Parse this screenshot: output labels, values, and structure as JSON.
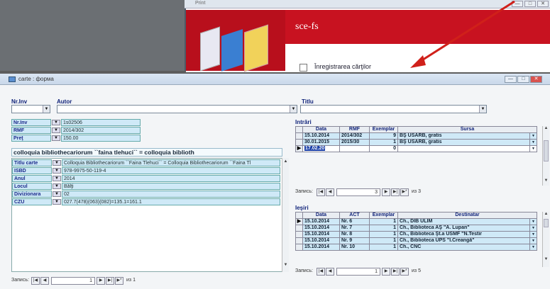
{
  "background_window": {
    "title": "Print",
    "brand": "sce-fs",
    "register_label": "Înregistrarea cărţilor"
  },
  "window": {
    "title": "carte : форма",
    "controls": [
      "—",
      "□",
      "✕"
    ]
  },
  "filters": {
    "nr_inv_label": "Nr.Inv",
    "autor_label": "Autor",
    "titlu_label": "Titlu"
  },
  "record": {
    "nr_inv": {
      "label": "Nr.Inv",
      "value": "1s02506"
    },
    "rmf": {
      "label": "RMF",
      "value": "2014/302"
    },
    "pret": {
      "label": "Preţ",
      "value": "150.00"
    },
    "title_line": "colloquia bibliothecariorum ``faina tlehuci`` = colloquia biblioth",
    "titlu_carte": {
      "label": "Titlu carte",
      "value": "Colloquia Bibliothecariorum ``Faina Tlehuci`` = Colloquia Bibliothecariorum ``Faina Tl"
    },
    "isbn": {
      "label": "ISBD",
      "value": "978-9975-50-119-4"
    },
    "anul": {
      "label": "Anul",
      "value": "2014"
    },
    "locul": {
      "label": "Locul",
      "value": "Bălţi"
    },
    "divizionara": {
      "label": "Divizionara",
      "value": "02"
    },
    "czu": {
      "label": "CZU",
      "value": "027.7(478)(063)(082)=135.1=161.1"
    }
  },
  "intrari": {
    "label": "Intrări",
    "headers": [
      "Data",
      "RMF",
      "Exemplar",
      "Sursa"
    ],
    "rows": [
      [
        "15.10.2014",
        "2014/302",
        "9",
        "BŞ USARB, gratis"
      ],
      [
        "30.01.2015",
        "2015/30",
        "1",
        "BŞ USARB, gratis"
      ],
      [
        "17.02.20",
        "",
        "0",
        ""
      ]
    ],
    "nav": {
      "label": "Запись:",
      "current": "3",
      "total_text": "из 3"
    }
  },
  "iesiri": {
    "label": "Ieşiri",
    "headers": [
      "Data",
      "ACT",
      "Exemplar",
      "Destinatar"
    ],
    "rows": [
      [
        "15.10.2014",
        "Nr. 6",
        "1",
        "Ch., DIB ULIM"
      ],
      [
        "15.10.2014",
        "Nr. 7",
        "1",
        "Ch., Biblioteca AŞ \"A. Lupan\""
      ],
      [
        "15.10.2014",
        "Nr. 8",
        "1",
        "Ch., Biblioteca Şt.a USMF \"N.Testir"
      ],
      [
        "15.10.2014",
        "Nr. 9",
        "1",
        "Ch., Biblioteca UPS \"I.Creangă\""
      ],
      [
        "15.10.2014",
        "Nr. 10",
        "1",
        "Ch., CNC"
      ]
    ],
    "nav": {
      "label": "Запись:",
      "current": "1",
      "total_text": "из 5"
    }
  },
  "main_nav": {
    "label": "Запись:",
    "current": "1",
    "total_text": "из 1"
  },
  "colors": {
    "field_bg": "#cfe9f7",
    "label_text": "#11247a",
    "brand_red": "#b80f1c",
    "arrow": "#d0201a"
  }
}
